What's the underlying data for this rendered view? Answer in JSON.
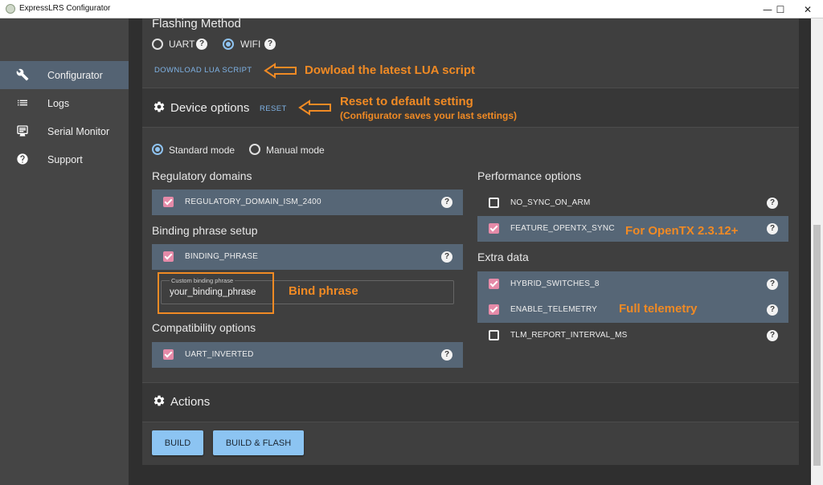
{
  "window": {
    "title": "ExpressLRS Configurator",
    "minimize": "—",
    "maximize": "☐",
    "close": "✕"
  },
  "sidebar": {
    "items": [
      {
        "label": "Configurator",
        "icon": "wrench-icon",
        "active": true
      },
      {
        "label": "Logs",
        "icon": "list-icon",
        "active": false
      },
      {
        "label": "Serial Monitor",
        "icon": "monitor-icon",
        "active": false
      },
      {
        "label": "Support",
        "icon": "help-circle-icon",
        "active": false
      }
    ]
  },
  "flashing": {
    "title": "Flashing Method",
    "options": [
      {
        "label": "UART",
        "selected": false
      },
      {
        "label": "WIFI",
        "selected": true
      }
    ],
    "download_link": "DOWNLOAD LUA SCRIPT"
  },
  "device_options": {
    "title": "Device options",
    "reset": "RESET",
    "modes": [
      {
        "label": "Standard mode",
        "selected": true
      },
      {
        "label": "Manual mode",
        "selected": false
      }
    ],
    "regulatory": {
      "title": "Regulatory domains",
      "items": [
        {
          "label": "REGULATORY_DOMAIN_ISM_2400",
          "checked": true
        }
      ]
    },
    "binding": {
      "title": "Binding phrase setup",
      "items": [
        {
          "label": "BINDING_PHRASE",
          "checked": true
        }
      ],
      "field_label": "Custom binding phrase",
      "field_value": "your_binding_phrase"
    },
    "compatibility": {
      "title": "Compatibility options",
      "items": [
        {
          "label": "UART_INVERTED",
          "checked": true
        }
      ]
    },
    "performance": {
      "title": "Performance options",
      "items": [
        {
          "label": "NO_SYNC_ON_ARM",
          "checked": false
        },
        {
          "label": "FEATURE_OPENTX_SYNC",
          "checked": true
        }
      ]
    },
    "extra": {
      "title": "Extra data",
      "items": [
        {
          "label": "HYBRID_SWITCHES_8",
          "checked": true
        },
        {
          "label": "ENABLE_TELEMETRY",
          "checked": true
        },
        {
          "label": "TLM_REPORT_INTERVAL_MS",
          "checked": false
        }
      ]
    }
  },
  "actions": {
    "title": "Actions",
    "build": "BUILD",
    "build_flash": "BUILD & FLASH"
  },
  "annotations": {
    "lua": "Dowload the latest LUA script",
    "reset_line1": "Reset to default setting",
    "reset_line2": "(Configurator saves your last settings)",
    "opentx": "For OpenTX 2.3.12+",
    "bind": "Bind phrase",
    "telemetry": "Full telemetry"
  },
  "colors": {
    "accent": "#8cc4f2",
    "checkbox": "#e58aa8",
    "annotation": "#f08a24",
    "highlight_row": "#566676"
  }
}
